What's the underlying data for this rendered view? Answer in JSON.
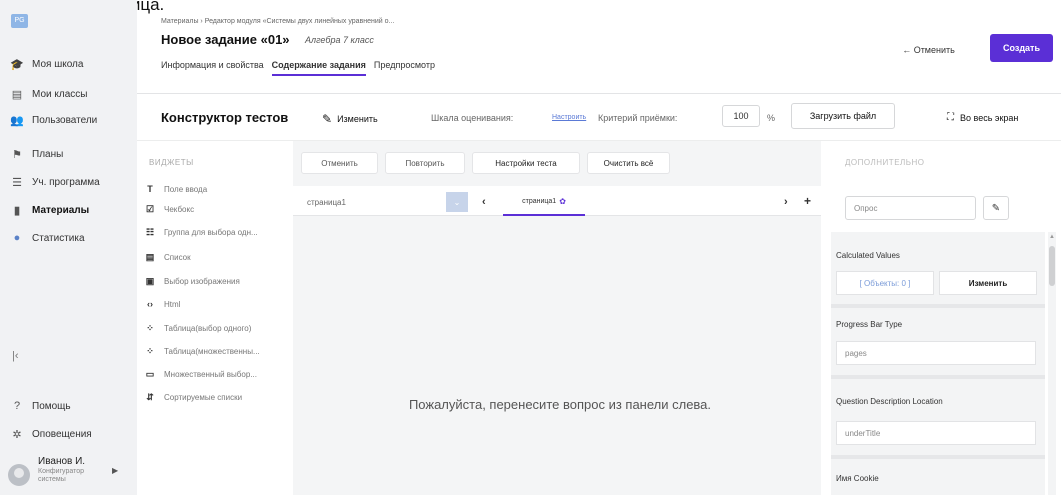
{
  "caption": "Откроется страница.",
  "sidebar": {
    "logo": "PG",
    "items": [
      {
        "label": "Моя школа",
        "icon": "graduation-icon",
        "glyph": "🎓"
      },
      {
        "label": "Мои классы",
        "icon": "classes-icon",
        "glyph": "▤"
      },
      {
        "label": "Пользователи",
        "icon": "users-icon",
        "glyph": "👥"
      },
      {
        "label": "Планы",
        "icon": "flag-icon",
        "glyph": "⚑"
      },
      {
        "label": "Уч. программа",
        "icon": "list-icon",
        "glyph": "☰"
      },
      {
        "label": "Материалы",
        "icon": "book-icon",
        "glyph": "▮"
      },
      {
        "label": "Статистика",
        "icon": "info-icon",
        "glyph": "●"
      }
    ],
    "collapse": "|‹",
    "help": "Помощь",
    "notifications": "Оповещения",
    "user": {
      "name": "Иванов И.",
      "role1": "Конфигуратор",
      "role2": "системы"
    }
  },
  "header": {
    "breadcrumb": "Материалы › Редактор модуля «Системы двух линейных уравнений о...",
    "title": "Новое задание «01»",
    "subtitle": "Алгебра 7 класс",
    "tabs": [
      "Информация и свойства",
      "Содержание задания",
      "Предпросмотр"
    ],
    "cancel": "← Отменить",
    "create": "Создать"
  },
  "toolbar": {
    "title": "Конструктор тестов",
    "edit": "Изменить",
    "scale_label": "Шкала оценивания:",
    "setup": "Настроить",
    "criterion_label": "Критерий приёмки:",
    "criterion_value": "100",
    "percent": "%",
    "upload": "Загрузить файл",
    "fullscreen": "Во весь экран"
  },
  "widgets": {
    "header": "ВИДЖЕТЫ",
    "items": [
      {
        "label": "Поле ввода",
        "glyph": "T"
      },
      {
        "label": "Чекбокс",
        "glyph": "☑"
      },
      {
        "label": "Группа для выбора одн...",
        "glyph": "☷"
      },
      {
        "label": "Список",
        "glyph": "▤"
      },
      {
        "label": "Выбор изображения",
        "glyph": "▣"
      },
      {
        "label": "Html",
        "glyph": "‹›"
      },
      {
        "label": "Таблица(выбор одного)",
        "glyph": "⁘"
      },
      {
        "label": "Таблица(множественны...",
        "glyph": "⁘"
      },
      {
        "label": "Множественный выбор...",
        "glyph": "▭"
      },
      {
        "label": "Сортируемые списки",
        "glyph": "⇵"
      }
    ]
  },
  "canvas": {
    "undo": "Отменить",
    "redo": "Повторить",
    "settings": "Настройки теста",
    "clear": "Очистить всё",
    "page_select": "страница1",
    "page_tab": "страница1",
    "drop_message": "Пожалуйста, перенесите вопрос из панели слева."
  },
  "properties": {
    "header": "ДОПОЛНИТЕЛЬНО",
    "search_value": "Опрос",
    "calculated_label": "Calculated Values",
    "objects": "[ Объекты: 0 ]",
    "change": "Изменить",
    "progress_label": "Progress Bar Type",
    "progress_value": "pages",
    "desc_label": "Question Description Location",
    "desc_value": "underTitle",
    "cookie_label": "Имя Cookie"
  },
  "colors": {
    "accent": "#5b2fd6"
  }
}
